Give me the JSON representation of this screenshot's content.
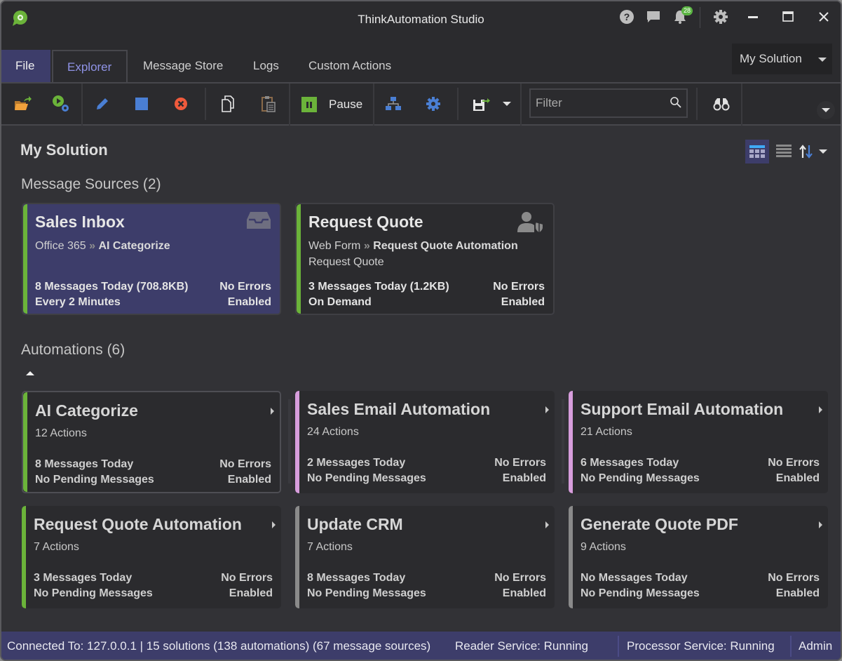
{
  "window": {
    "title": "ThinkAutomation Studio",
    "notification_count": "28"
  },
  "tabs": [
    {
      "label": "File"
    },
    {
      "label": "Explorer"
    },
    {
      "label": "Message Store"
    },
    {
      "label": "Logs"
    },
    {
      "label": "Custom Actions"
    }
  ],
  "solution_select": {
    "value": "My Solution"
  },
  "toolbar": {
    "pause_label": "Pause",
    "filter_placeholder": "Filter"
  },
  "main": {
    "title": "My Solution",
    "message_sources_heading": "Message Sources (2)",
    "automations_heading": "Automations (6)"
  },
  "message_sources": [
    {
      "name": "Sales Inbox",
      "source_type": "Office 365",
      "automation": "AI Categorize",
      "extra": "",
      "messages": "8 Messages Today (708.8KB)",
      "schedule": "Every 2 Minutes",
      "errors": "No Errors",
      "status": "Enabled",
      "icon": "inbox-icon",
      "accent": "#6bb33a"
    },
    {
      "name": "Request Quote",
      "source_type": "Web Form",
      "automation": "Request Quote Automation",
      "extra": "Request Quote",
      "messages": "3 Messages Today (1.2KB)",
      "schedule": "On Demand",
      "errors": "No Errors",
      "status": "Enabled",
      "icon": "user-shield-icon",
      "accent": "#6bb33a"
    }
  ],
  "automations": [
    {
      "name": "AI Categorize",
      "actions": "12 Actions",
      "messages": "8 Messages Today",
      "pending": "No Pending Messages",
      "errors": "No Errors",
      "status": "Enabled",
      "accent": "#6bb33a"
    },
    {
      "name": "Sales Email Automation",
      "actions": "24 Actions",
      "messages": "2 Messages Today",
      "pending": "No Pending Messages",
      "errors": "No Errors",
      "status": "Enabled",
      "accent": "#d79ddc"
    },
    {
      "name": "Support Email Automation",
      "actions": "21 Actions",
      "messages": "6 Messages Today",
      "pending": "No Pending Messages",
      "errors": "No Errors",
      "status": "Enabled",
      "accent": "#d79ddc"
    },
    {
      "name": "Request Quote Automation",
      "actions": "7 Actions",
      "messages": "3 Messages Today",
      "pending": "No Pending Messages",
      "errors": "No Errors",
      "status": "Enabled",
      "accent": "#6bb33a"
    },
    {
      "name": "Update CRM",
      "actions": "7 Actions",
      "messages": "8 Messages Today",
      "pending": "No Pending Messages",
      "errors": "No Errors",
      "status": "Enabled",
      "accent": "#8a8a8a"
    },
    {
      "name": "Generate Quote PDF",
      "actions": "9 Actions",
      "messages": "No Messages Today",
      "pending": "No Pending Messages",
      "errors": "No Errors",
      "status": "Enabled",
      "accent": "#8a8a8a"
    }
  ],
  "statusbar": {
    "connection": "Connected To: 127.0.0.1 | 15 solutions (138 automations) (67 message sources)",
    "reader": "Reader Service: Running",
    "processor": "Processor Service: Running",
    "user": "Admin"
  },
  "colors": {
    "accent_primary": "#3d3d6a",
    "tab_active_text": "#8f93e6",
    "accent_green": "#6bb33a",
    "accent_pink": "#d79ddc",
    "accent_gray": "#8a8a8a"
  }
}
